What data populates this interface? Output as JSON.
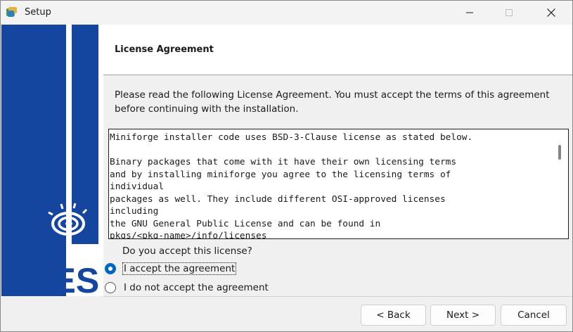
{
  "window": {
    "title": "Setup"
  },
  "banner": {
    "logo_text": "INTES",
    "brand_color": "#1446a0"
  },
  "header": {
    "title": "License Agreement"
  },
  "instructions": "Please read the following License Agreement. You must accept the terms of this agreement before continuing with the installation.",
  "license": {
    "lines": [
      "Miniforge installer code uses BSD-3-Clause license as stated below.",
      "",
      "Binary packages that come with it have their own licensing terms",
      "and by installing miniforge you agree to the licensing terms of",
      "individual",
      "packages as well. They include different OSI-approved licenses",
      "including",
      "the GNU General Public License and can be found in",
      "pkgs/<pkg-name>/info/licenses"
    ]
  },
  "question": "Do you accept this license?",
  "options": [
    {
      "label": "I accept the agreement",
      "checked": true
    },
    {
      "label": "I do not accept the agreement",
      "checked": false
    }
  ],
  "buttons": {
    "back": "< Back",
    "next": "Next >",
    "cancel": "Cancel"
  },
  "colors": {
    "accent": "#0067c0"
  }
}
